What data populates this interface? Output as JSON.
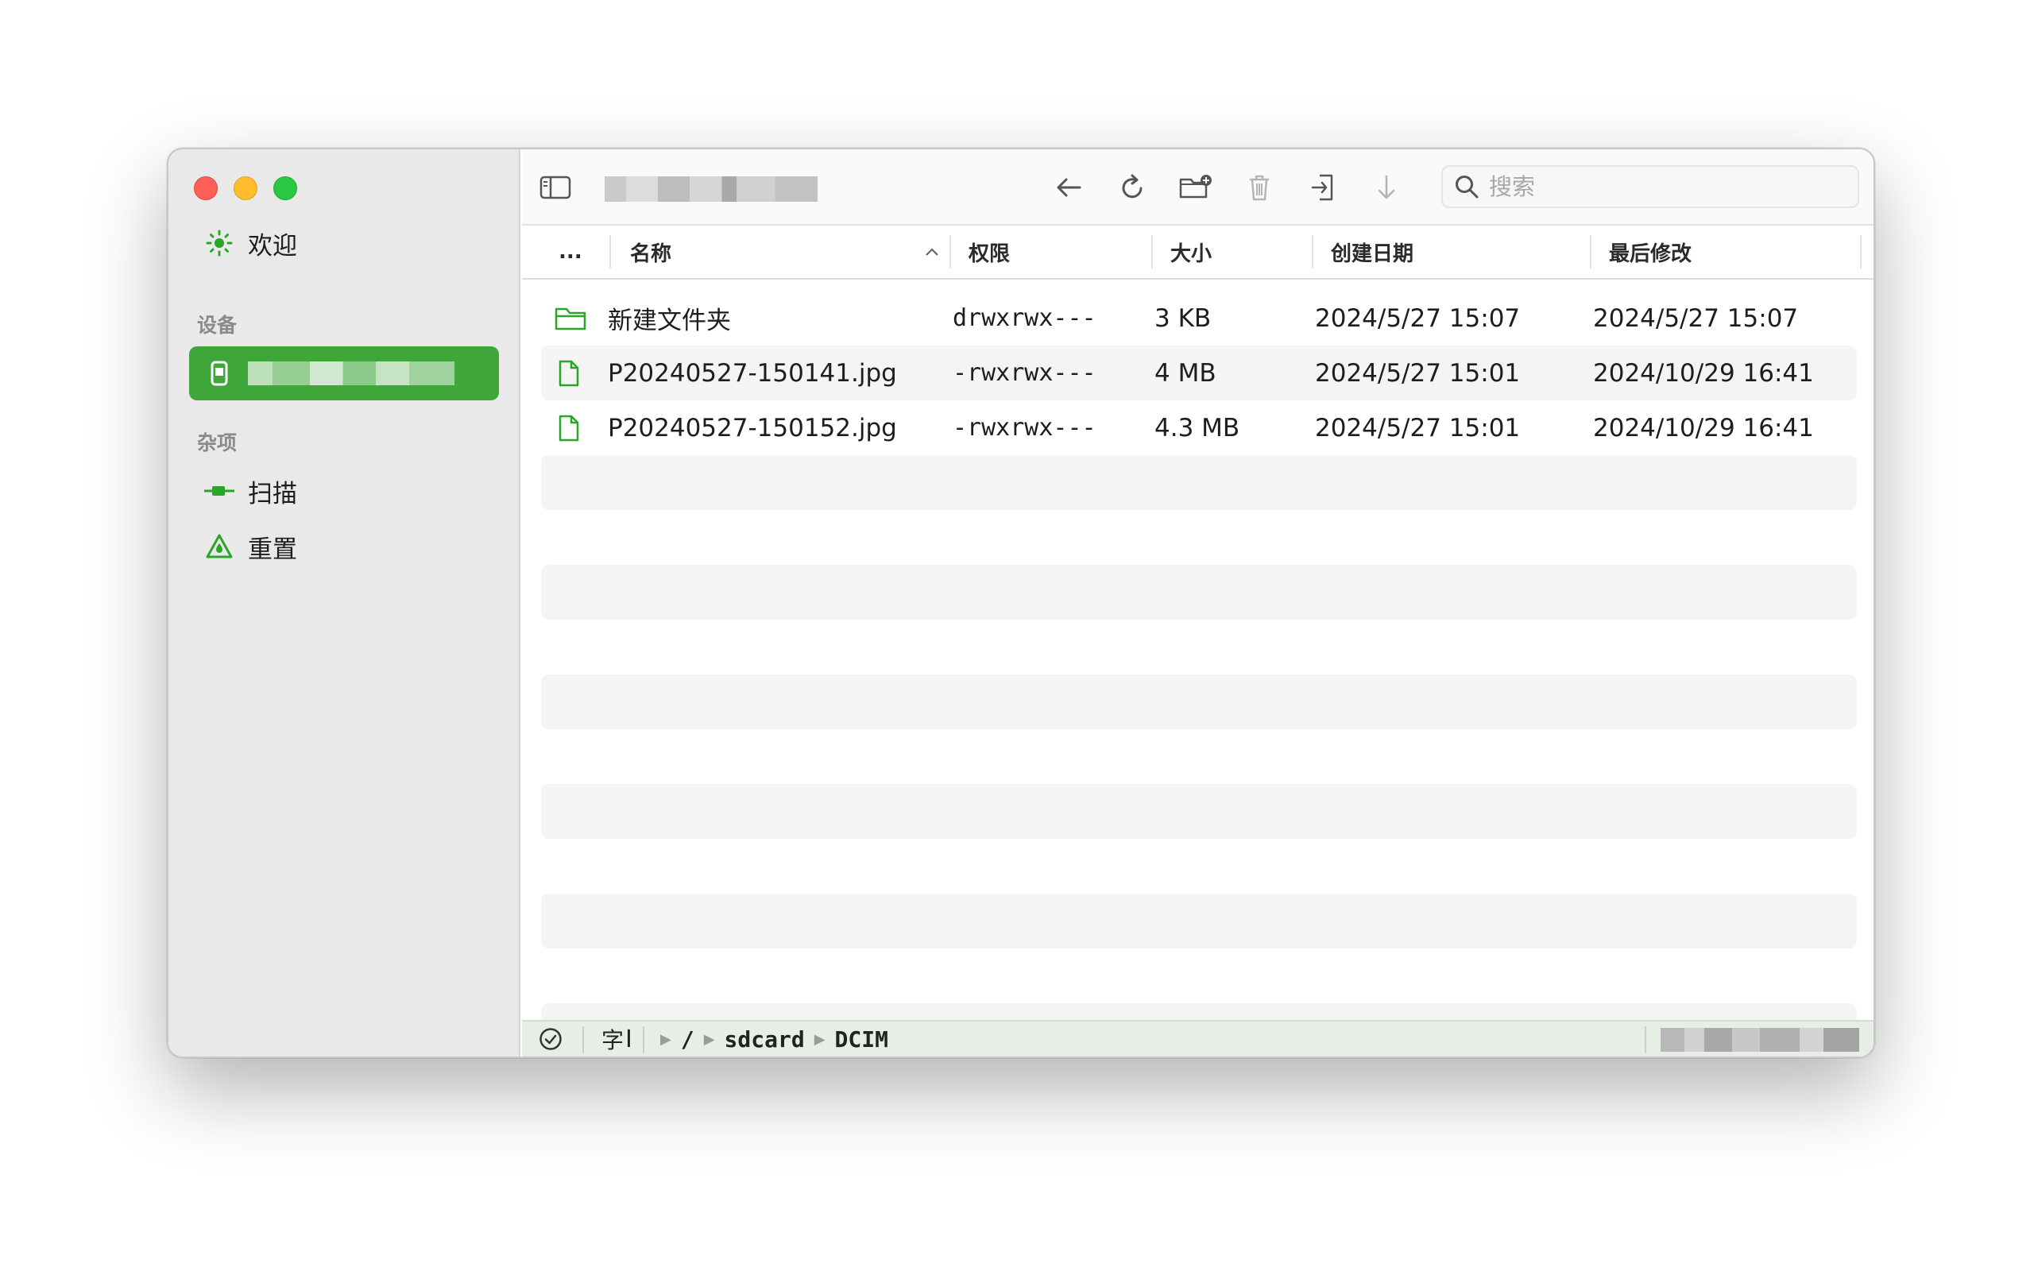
{
  "sidebar": {
    "welcome_label": "欢迎",
    "devices_header": "设备",
    "device_label": "",
    "misc_header": "杂项",
    "scan_label": "扫描",
    "reset_label": "重置"
  },
  "search": {
    "placeholder": "搜索"
  },
  "columns": {
    "more": "...",
    "name": "名称",
    "permissions": "权限",
    "size": "大小",
    "created": "创建日期",
    "modified": "最后修改"
  },
  "files": [
    {
      "name": "新建文件夹",
      "type": "folder",
      "permissions": "drwxrwx---",
      "size": "3 KB",
      "created": "2024/5/27 15:07",
      "modified": "2024/5/27 15:07"
    },
    {
      "name": "P20240527-150141.jpg",
      "type": "file",
      "permissions": "-rwxrwx---",
      "size": "4 MB",
      "created": "2024/5/27 15:01",
      "modified": "2024/10/29 16:41"
    },
    {
      "name": "P20240527-150152.jpg",
      "type": "file",
      "permissions": "-rwxrwx---",
      "size": "4.3 MB",
      "created": "2024/5/27 15:01",
      "modified": "2024/10/29 16:41"
    }
  ],
  "status": {
    "encoding_icon_label": "字",
    "path": [
      "/",
      "sdcard",
      "DCIM"
    ]
  },
  "colors": {
    "accent": "#3fa63a",
    "icon_green": "#2aa52a"
  }
}
